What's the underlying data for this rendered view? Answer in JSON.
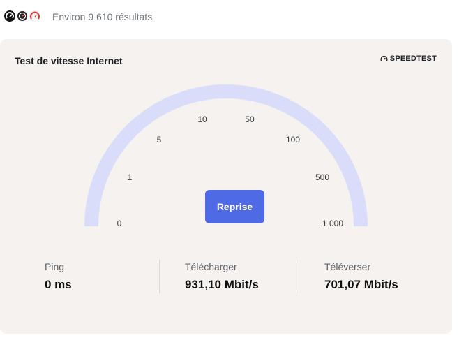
{
  "header": {
    "results_text": "Environ 9 610 résultats",
    "source_icons": [
      "speedtest-logo-icon",
      "speedometer-dark-icon",
      "speedometer-red-icon"
    ]
  },
  "widget": {
    "title": "Test de vitesse Internet",
    "brand": "SPEEDTEST",
    "brand_icon": "gauge-icon",
    "button_label": "Reprise",
    "gauge_progress": 0,
    "gauge_labels": [
      "0",
      "1",
      "5",
      "10",
      "50",
      "100",
      "500",
      "1 000"
    ],
    "colors": {
      "track": "#d9ddfa",
      "button": "#4f6ae5",
      "card_bg": "#f5f2ef"
    },
    "metrics": [
      {
        "label": "Ping",
        "value": "0 ms"
      },
      {
        "label": "Télécharger",
        "value": "931,10 Mbit/s"
      },
      {
        "label": "Téléverser",
        "value": "701,07 Mbit/s"
      }
    ]
  }
}
